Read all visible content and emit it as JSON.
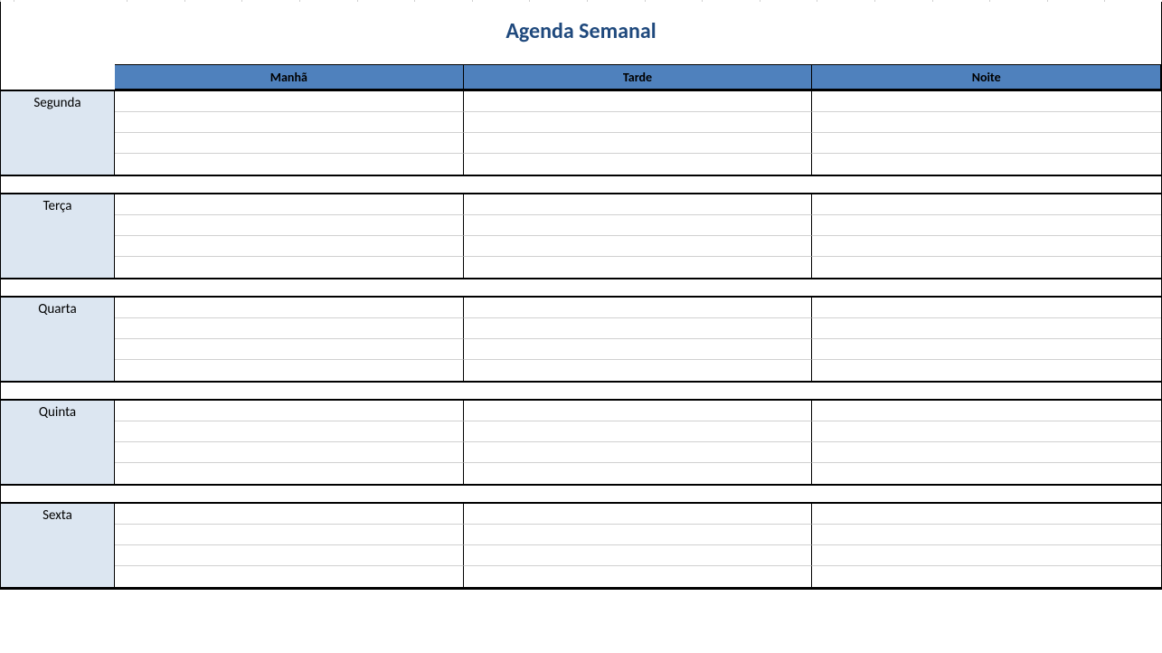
{
  "title": "Agenda Semanal",
  "periods": [
    "Manhã",
    "Tarde",
    "Noite"
  ],
  "days": [
    {
      "name": "Segunda",
      "entries": [
        [
          "",
          "",
          ""
        ],
        [
          "",
          "",
          ""
        ],
        [
          "",
          "",
          ""
        ],
        [
          "",
          "",
          ""
        ]
      ]
    },
    {
      "name": "Terça",
      "entries": [
        [
          "",
          "",
          ""
        ],
        [
          "",
          "",
          ""
        ],
        [
          "",
          "",
          ""
        ],
        [
          "",
          "",
          ""
        ]
      ]
    },
    {
      "name": "Quarta",
      "entries": [
        [
          "",
          "",
          ""
        ],
        [
          "",
          "",
          ""
        ],
        [
          "",
          "",
          ""
        ],
        [
          "",
          "",
          ""
        ]
      ]
    },
    {
      "name": "Quinta",
      "entries": [
        [
          "",
          "",
          ""
        ],
        [
          "",
          "",
          ""
        ],
        [
          "",
          "",
          ""
        ],
        [
          "",
          "",
          ""
        ]
      ]
    },
    {
      "name": "Sexta",
      "entries": [
        [
          "",
          "",
          ""
        ],
        [
          "",
          "",
          ""
        ],
        [
          "",
          "",
          ""
        ],
        [
          "",
          "",
          ""
        ]
      ]
    }
  ],
  "top_grid_widths": [
    15,
    126,
    64,
    64,
    64,
    64,
    64,
    64,
    64,
    64,
    64,
    64,
    64,
    64,
    64,
    64,
    64,
    64,
    64,
    64
  ]
}
